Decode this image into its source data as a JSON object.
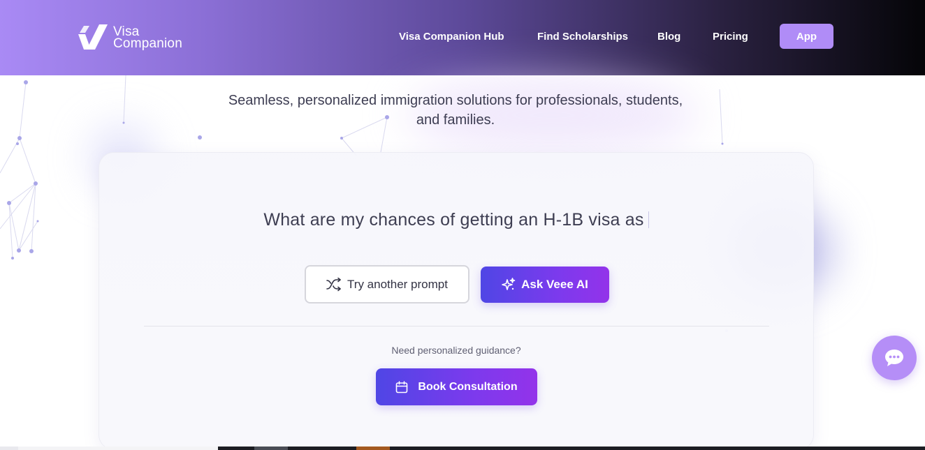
{
  "brand": {
    "name_line1": "Visa",
    "name_line2": "Companion",
    "logo_icon": "visa-companion-logo-icon"
  },
  "nav": {
    "items": [
      {
        "label": "Visa Companion Hub"
      },
      {
        "label": "Find Scholarships"
      },
      {
        "label": "Blog"
      },
      {
        "label": "Pricing"
      }
    ],
    "app_button": "App"
  },
  "hero": {
    "subtitle_line1": "Seamless, personalized immigration solutions for professionals, students,",
    "subtitle_line2": "and families."
  },
  "card": {
    "prompt_text": "What are my chances of getting an H-1B visa as",
    "try_button": "Try another prompt",
    "try_icon": "shuffle-icon",
    "ask_button": "Ask Veee AI",
    "ask_icon": "sparkles-icon",
    "guidance_text": "Need personalized guidance?",
    "book_button": "Book Consultation",
    "book_icon": "calendar-icon"
  },
  "chat": {
    "icon": "chat-bubble-icon"
  },
  "colors": {
    "header_gradient_start": "#a98af5",
    "header_gradient_end": "#050508",
    "accent_purple": "#7c3aed",
    "accent_indigo": "#4f46e5",
    "app_button": "#b08cf7",
    "chat_button": "#b58ef7"
  }
}
